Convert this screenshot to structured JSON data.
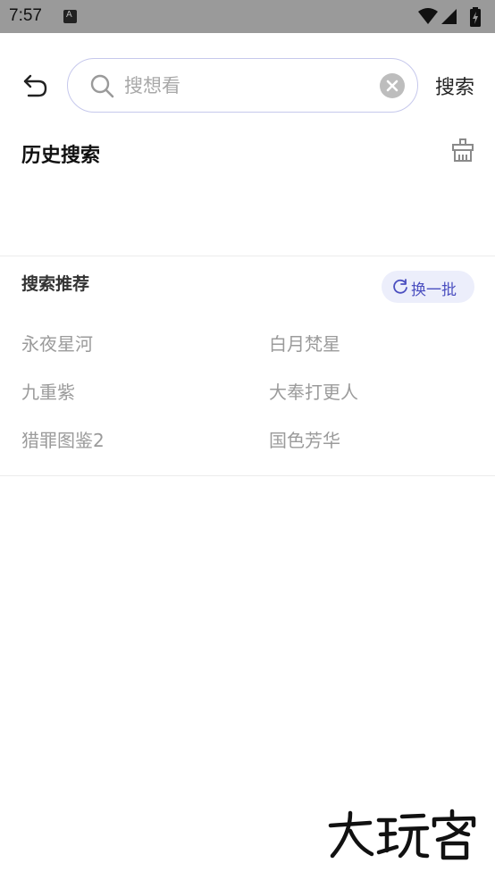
{
  "status_bar": {
    "time": "7:57"
  },
  "search": {
    "placeholder": "搜想看",
    "value": "",
    "submit_label": "搜索"
  },
  "history": {
    "title": "历史搜索"
  },
  "recommend": {
    "title": "搜索推荐",
    "refresh_label": "换一批",
    "accent_color": "#4b4fc0",
    "items": [
      "永夜星河",
      "白月梵星",
      "九重紫",
      "大奉打更人",
      "猎罪图鉴2",
      "国色芳华"
    ]
  },
  "watermark": {
    "text": "大玩客"
  }
}
